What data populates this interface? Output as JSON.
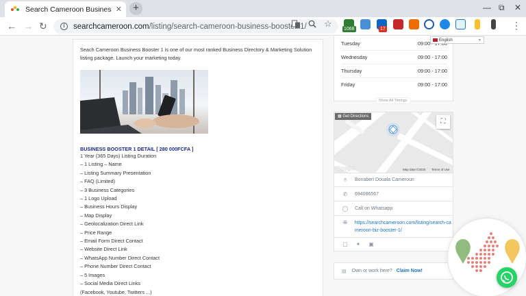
{
  "browser": {
    "tab_title": "Search Cameroon Business Boo",
    "tab_close": "✕",
    "new_tab": "+",
    "window_controls": {
      "minimize": "—",
      "restore": "⧉",
      "close": "✕"
    },
    "url_domain": "searchcameroon.com",
    "url_path": "/listing/search-cameroon-business-booster-1/",
    "extensions": {
      "badge1": "1068",
      "badge2": "17"
    },
    "translate_language": "English"
  },
  "listing": {
    "intro": "Seach Cameroon Business Booster 1 is one of our most ranked Business Directory & Marketing Solution listing package. Launch your marketing today.",
    "detail_title": "BUSINESS BOOSTER 1 DETAIL [ 280 000FCFA ]",
    "detail_items": [
      "1 Year (365 Days) Listing Duration",
      "– 1 Listing – Name",
      "– Listing Summary Presentation",
      "– FAQ (Limited)",
      "– 3 Business Categories",
      "– 1 Logo Upload",
      "– Business Hours Display",
      "– Map Display",
      "– Geolocalization Direct Link",
      "– Price Range",
      "– Email Form Direct Contact",
      "– Website Direct Link",
      "– WhatsApp Number Direct Contact",
      "– Phone Number Direct Contact",
      "– 5 Images",
      "– Social Media Direct Links",
      "(Facebook, Youtube, Twitters ...)"
    ]
  },
  "hours": {
    "rows": [
      {
        "day": "Tuesday",
        "time": "09:00 - 17:00"
      },
      {
        "day": "Wednesday",
        "time": "09:00 - 17:00"
      },
      {
        "day": "Thursday",
        "time": "09:00 - 17:00"
      },
      {
        "day": "Friday",
        "time": "09:00 - 17:00"
      }
    ],
    "show_all": "Show All Timings"
  },
  "map": {
    "get_directions": "Get Directions",
    "google": "Google",
    "map_data": "Map data ©2020",
    "terms": "Terms of Use"
  },
  "contact": {
    "address": "Bonaberi Douala Cameroun",
    "phone": "694086567",
    "whatsapp": "Call on Whatsapp",
    "website": "https://searchcameroon.com/listing/search-cameroon-biz-booster-1/"
  },
  "claim": {
    "question": "Own or work here?",
    "link": "Claim Now!"
  }
}
